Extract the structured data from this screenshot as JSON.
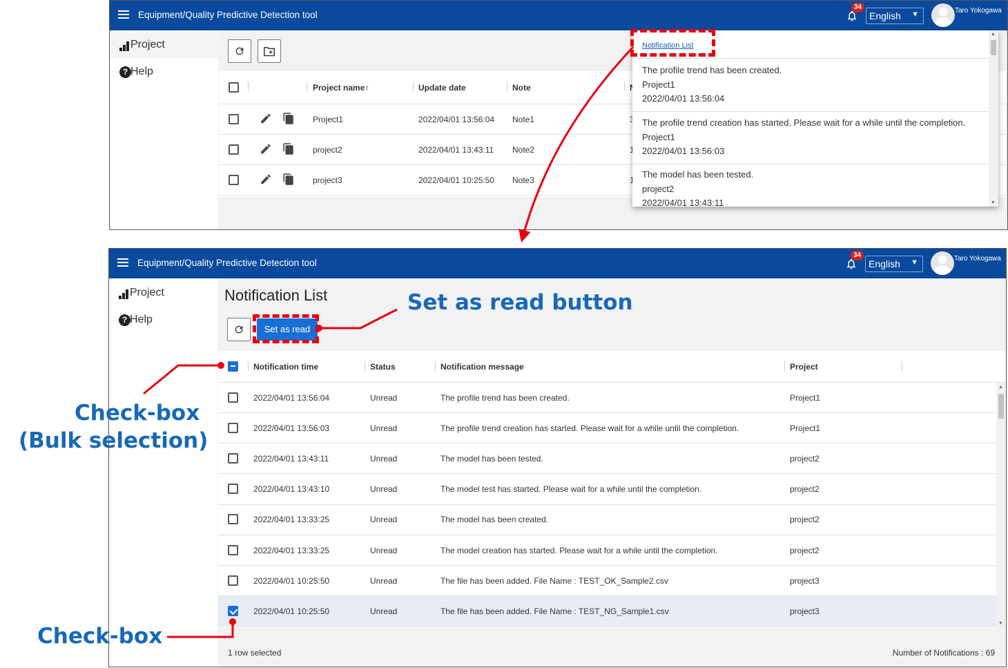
{
  "app": {
    "title": "Equipment/Quality Predictive Detection tool",
    "notification_count": "34",
    "language": "English",
    "user_name": "Taro Yokogawa",
    "brand_color": "#0a4a9e",
    "accent_color": "#1a6fd6",
    "annotation_color": "#e8000e",
    "callout_color": "#1769b8"
  },
  "sidebar": {
    "items": [
      {
        "label": "Project",
        "icon": "bar-chart-icon"
      },
      {
        "label": "Help",
        "icon": "help-circle-icon"
      }
    ]
  },
  "project_screen": {
    "columns": [
      "Project name",
      "Update date",
      "Note",
      "N"
    ],
    "rows": [
      {
        "name": "Project1",
        "date": "2022/04/01 13:56:04",
        "note": "Note1",
        "extra": "3"
      },
      {
        "name": "project2",
        "date": "2022/04/01 13:43:11",
        "note": "Note2",
        "extra": "1"
      },
      {
        "name": "project3",
        "date": "2022/04/01 10:25:50",
        "note": "Note3",
        "extra": "1"
      }
    ]
  },
  "notification_panel": {
    "link": "Notification List",
    "items": [
      {
        "message": "The profile trend has been created.",
        "project": "Project1",
        "time": "2022/04/01 13:56:04"
      },
      {
        "message": "The profile trend creation has started. Please wait for a while until the completion.",
        "project": "Project1",
        "time": "2022/04/01 13:56:03"
      },
      {
        "message": "The model has been tested.",
        "project": "project2",
        "time": "2022/04/01 13:43:11"
      }
    ]
  },
  "notification_screen": {
    "title": "Notification List",
    "set_read_label": "Set as read",
    "columns": [
      "Notification time",
      "Status",
      "Notification message",
      "Project"
    ],
    "rows": [
      {
        "time": "2022/04/01 13:56:04",
        "status": "Unread",
        "message": "The profile trend has been created.",
        "project": "Project1",
        "checked": false
      },
      {
        "time": "2022/04/01 13:56:03",
        "status": "Unread",
        "message": "The profile trend creation has started. Please wait for a while until the completion.",
        "project": "Project1",
        "checked": false
      },
      {
        "time": "2022/04/01 13:43:11",
        "status": "Unread",
        "message": "The model has been tested.",
        "project": "project2",
        "checked": false
      },
      {
        "time": "2022/04/01 13:43:10",
        "status": "Unread",
        "message": "The model test has started. Please wait for a while until the completion.",
        "project": "project2",
        "checked": false
      },
      {
        "time": "2022/04/01 13:33:25",
        "status": "Unread",
        "message": "The model has been created.",
        "project": "project2",
        "checked": false
      },
      {
        "time": "2022/04/01 13:33:25",
        "status": "Unread",
        "message": "The model creation has started. Please wait for a while until the completion.",
        "project": "project2",
        "checked": false
      },
      {
        "time": "2022/04/01 10:25:50",
        "status": "Unread",
        "message": "The file has been added. File Name : TEST_OK_Sample2.csv",
        "project": "project3",
        "checked": false
      },
      {
        "time": "2022/04/01 10:25:50",
        "status": "Unread",
        "message": "The file has been added. File Name : TEST_NG_Sample1.csv",
        "project": "project3",
        "checked": true
      }
    ],
    "selected_text": "1 row selected",
    "count_text": "Number of Notifications : 69"
  },
  "annotations": {
    "set_read": "Set as read button",
    "bulk_line1": "Check-box",
    "bulk_line2": "(Bulk selection)",
    "single": "Check-box"
  }
}
